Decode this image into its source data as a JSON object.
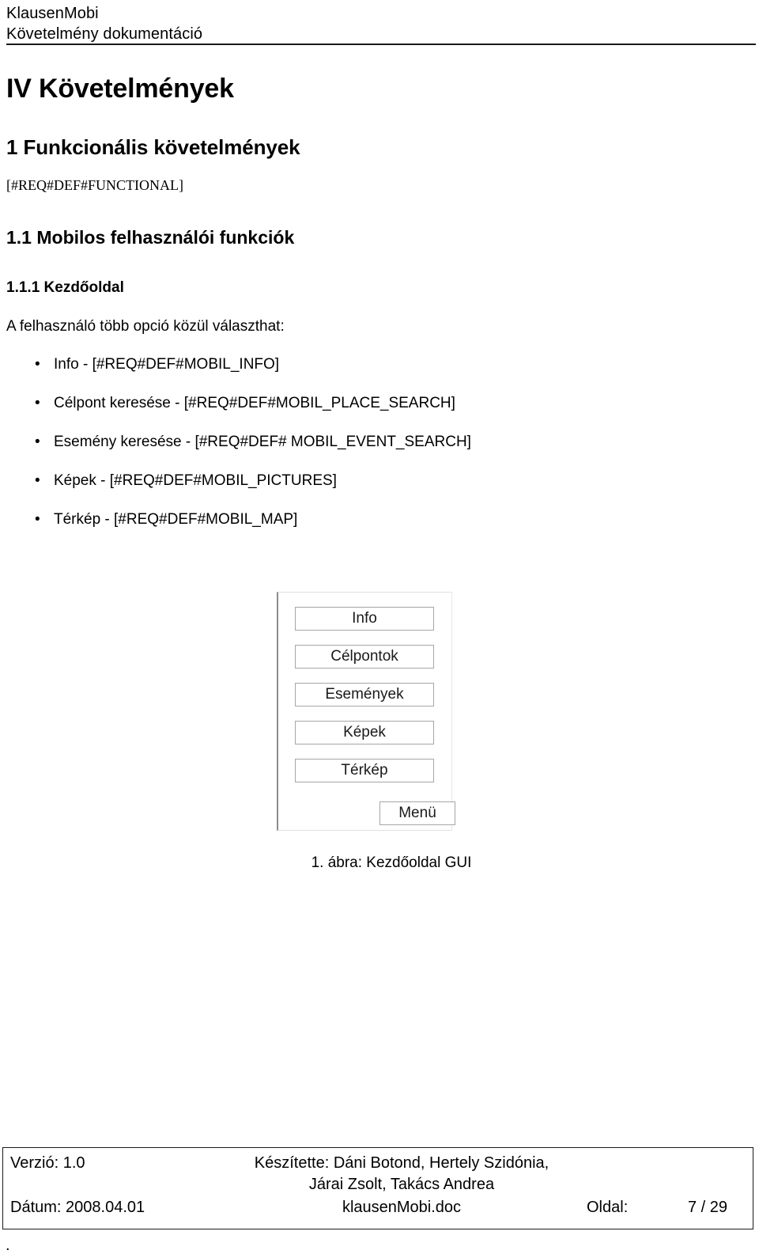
{
  "header": {
    "line1": "KlausenMobi",
    "line2": "Követelmény dokumentáció"
  },
  "content": {
    "chapter_title": "IV Követelmények",
    "section_1": "1 Funkcionális követelmények",
    "tag_functional": "[#REQ#DEF#FUNCTIONAL]",
    "section_1_1": "1.1 Mobilos felhasználói funkciók",
    "section_1_1_1": "1.1.1 Kezdőoldal",
    "intro_paragraph": "A felhasználó több opció közül választhat:",
    "bullet_char": "•",
    "options": [
      "Info - [#REQ#DEF#MOBIL_INFO]",
      "Célpont keresése - [#REQ#DEF#MOBIL_PLACE_SEARCH]",
      "Esemény keresése - [#REQ#DEF# MOBIL_EVENT_SEARCH]",
      "Képek - [#REQ#DEF#MOBIL_PICTURES]",
      "Térkép - [#REQ#DEF#MOBIL_MAP]"
    ]
  },
  "figure": {
    "caption": "1. ábra: Kezdőoldal GUI",
    "gui_buttons": [
      "Info",
      "Célpontok",
      "Események",
      "Képek",
      "Térkép"
    ],
    "menu_button": "Menü"
  },
  "footer": {
    "version_label": "Verzió: 1.0",
    "authors_line1": "Készítette: Dáni Botond, Hertely Szidónia,",
    "authors_line2": "Járai Zsolt, Takács Andrea",
    "date_label": "Dátum: 2008.04.01",
    "filename": "klausenMobi.doc",
    "page_label": "Oldal:",
    "page_value": "7 / 29",
    "stray_mark": "."
  },
  "colors": {
    "text": "#000000",
    "rule": "#1a1a1a",
    "button_border": "#a6a6a6",
    "frame_border": "#8c8c8c"
  }
}
